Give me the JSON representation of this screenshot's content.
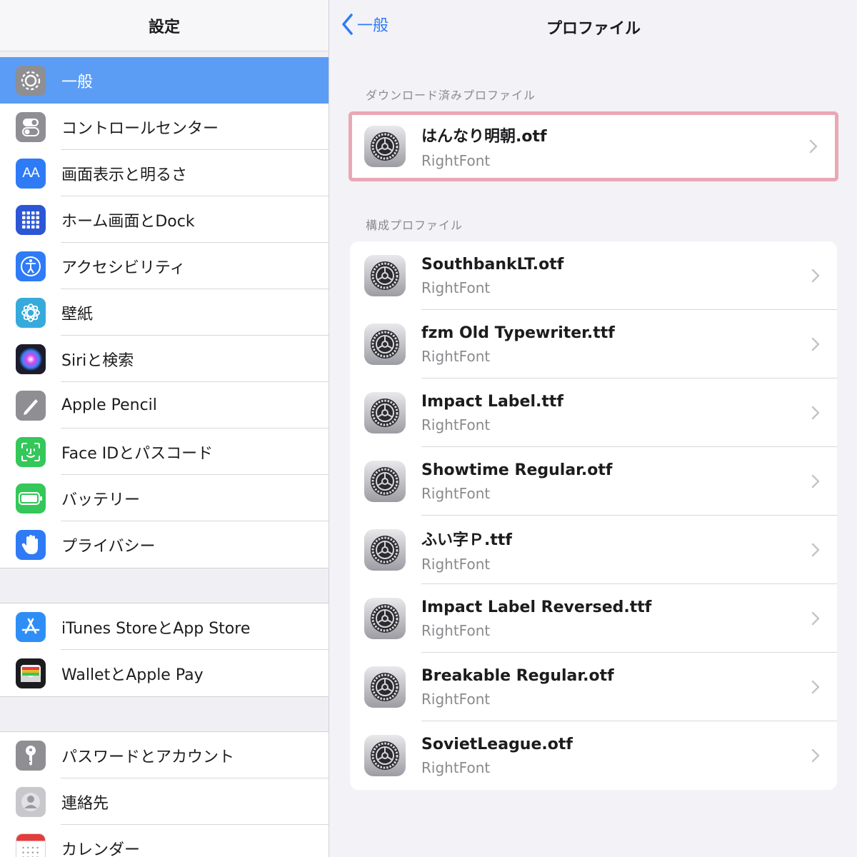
{
  "master": {
    "title": "設定",
    "groups": [
      [
        {
          "label": "一般",
          "icon": "gear-icon",
          "bg": "#8e8e93",
          "selected": true
        },
        {
          "label": "コントロールセンター",
          "icon": "toggles-icon",
          "bg": "#8e8e93"
        },
        {
          "label": "画面表示と明るさ",
          "icon": "text-size-icon",
          "bg": "#2f7bf6"
        },
        {
          "label": "ホーム画面とDock",
          "icon": "app-grid-icon",
          "bg": "#2c56d6"
        },
        {
          "label": "アクセシビリティ",
          "icon": "accessibility-icon",
          "bg": "#2f7bf6"
        },
        {
          "label": "壁紙",
          "icon": "flower-icon",
          "bg": "#37aadc"
        },
        {
          "label": "Siriと検索",
          "icon": "siri-icon",
          "bg": "#1c1c2e"
        },
        {
          "label": "Apple Pencil",
          "icon": "pencil-icon",
          "bg": "#8e8e93"
        },
        {
          "label": "Face IDとパスコード",
          "icon": "face-id-icon",
          "bg": "#34c759"
        },
        {
          "label": "バッテリー",
          "icon": "battery-icon",
          "bg": "#34c759"
        },
        {
          "label": "プライバシー",
          "icon": "hand-icon",
          "bg": "#2f7bf6"
        }
      ],
      [
        {
          "label": "iTunes StoreとApp Store",
          "icon": "app-store-icon",
          "bg": "#2f8ef6"
        },
        {
          "label": "WalletとApple Pay",
          "icon": "wallet-icon",
          "bg": "#1c1c1e"
        }
      ],
      [
        {
          "label": "パスワードとアカウント",
          "icon": "key-icon",
          "bg": "#8e8e93"
        },
        {
          "label": "連絡先",
          "icon": "contacts-icon",
          "bg": "#c8c8cc"
        },
        {
          "label": "カレンダー",
          "icon": "calendar-icon",
          "bg": "#ffffff"
        }
      ]
    ]
  },
  "detail": {
    "back_label": "一般",
    "title": "プロファイル",
    "downloaded_header": "ダウンロード済みプロファイル",
    "downloaded": [
      {
        "name": "はんなり明朝.otf",
        "sub": "RightFont"
      }
    ],
    "config_header": "構成プロファイル",
    "config": [
      {
        "name": "SouthbankLT.otf",
        "sub": "RightFont"
      },
      {
        "name": "fzm Old Typewriter.ttf",
        "sub": "RightFont"
      },
      {
        "name": "Impact Label.ttf",
        "sub": "RightFont"
      },
      {
        "name": "Showtime Regular.otf",
        "sub": "RightFont"
      },
      {
        "name": "ふい字Ｐ.ttf",
        "sub": "RightFont"
      },
      {
        "name": "Impact Label Reversed.ttf",
        "sub": "RightFont"
      },
      {
        "name": "Breakable  Regular.otf",
        "sub": "RightFont"
      },
      {
        "name": "SovietLeague.otf",
        "sub": "RightFont"
      }
    ],
    "highlight_color": "#e9a8b4",
    "accent_color": "#2f7bf6"
  }
}
